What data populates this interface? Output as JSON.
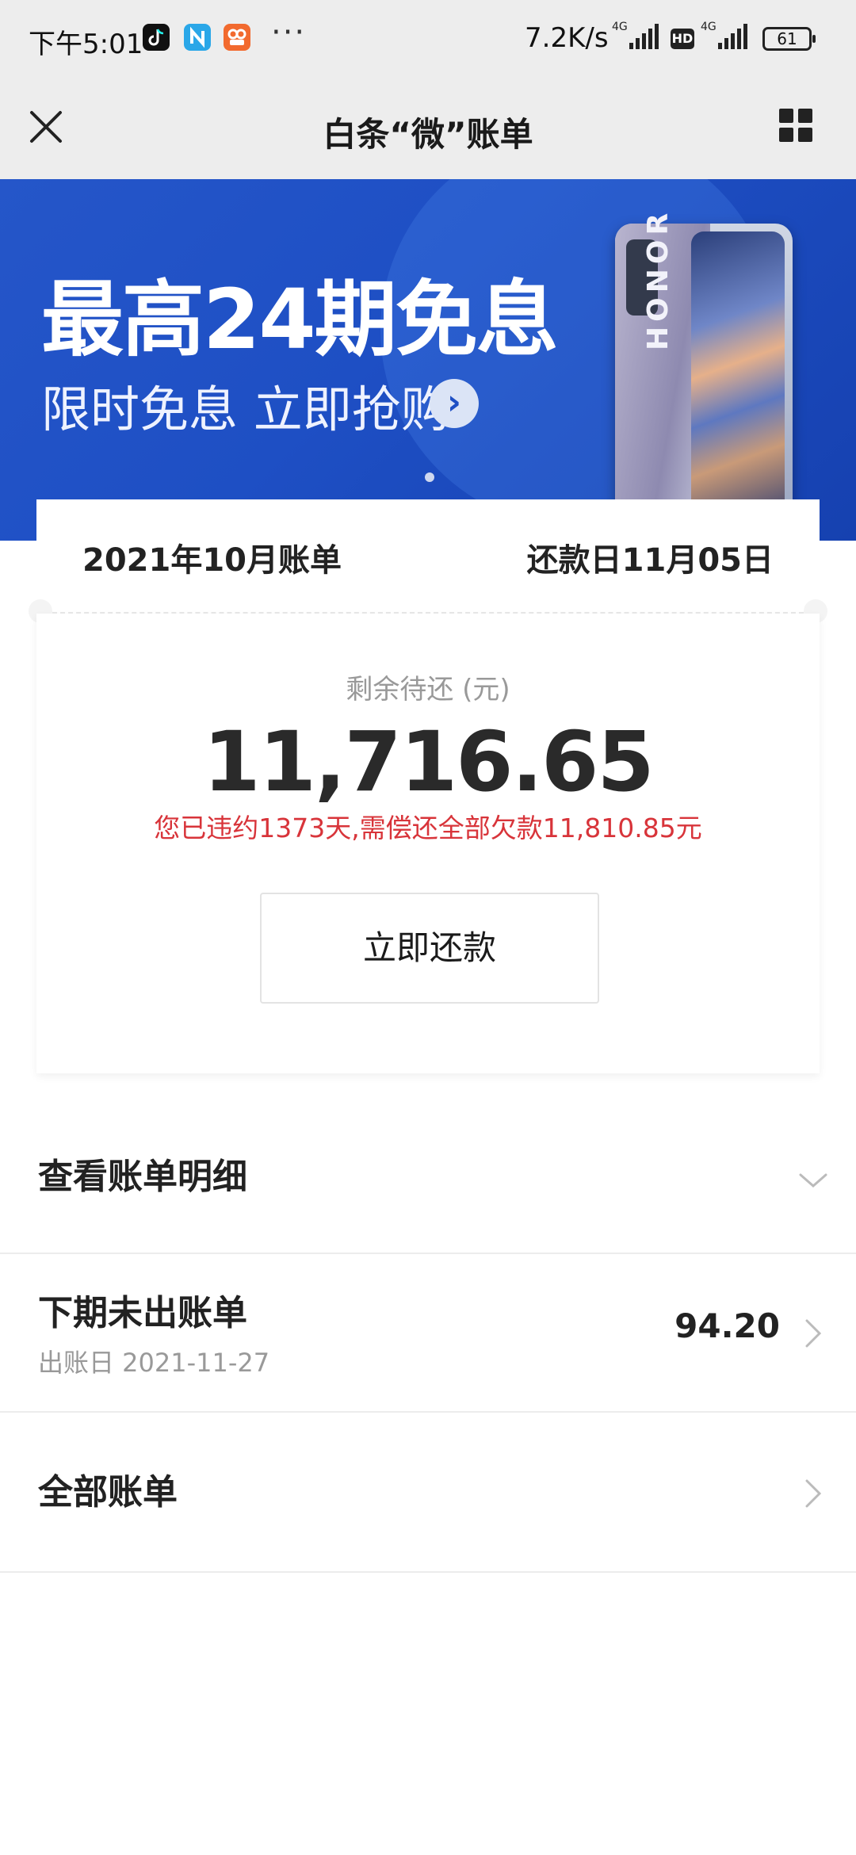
{
  "status_bar": {
    "time": "下午5:01",
    "network_speed": "7.2K/s",
    "signal_label": "4G",
    "hd_label": "HD",
    "battery": "61",
    "more": "···"
  },
  "header": {
    "title": "白条“微”账单"
  },
  "banner": {
    "headline": "最高24期免息",
    "subline": "限时免息 立即抢购",
    "phone_brand": "HONOR"
  },
  "bill": {
    "month_label": "2021年10月账单",
    "due_label": "还款日11月05日",
    "remaining_label": "剩余待还 (元)",
    "remaining_amount": "11,716.65",
    "overdue_notice": "您已违约1373天,需偿还全部欠款11,810.85元",
    "repay_button": "立即还款"
  },
  "list": {
    "detail_title": "查看账单明细",
    "next_title": "下期未出账单",
    "next_sub": "出账日 2021-11-27",
    "next_value": "94.20",
    "all_title": "全部账单"
  },
  "colors": {
    "banner_blue": "#1e4fc4",
    "warning_red": "#d8343a",
    "header_gray": "#ededed"
  }
}
